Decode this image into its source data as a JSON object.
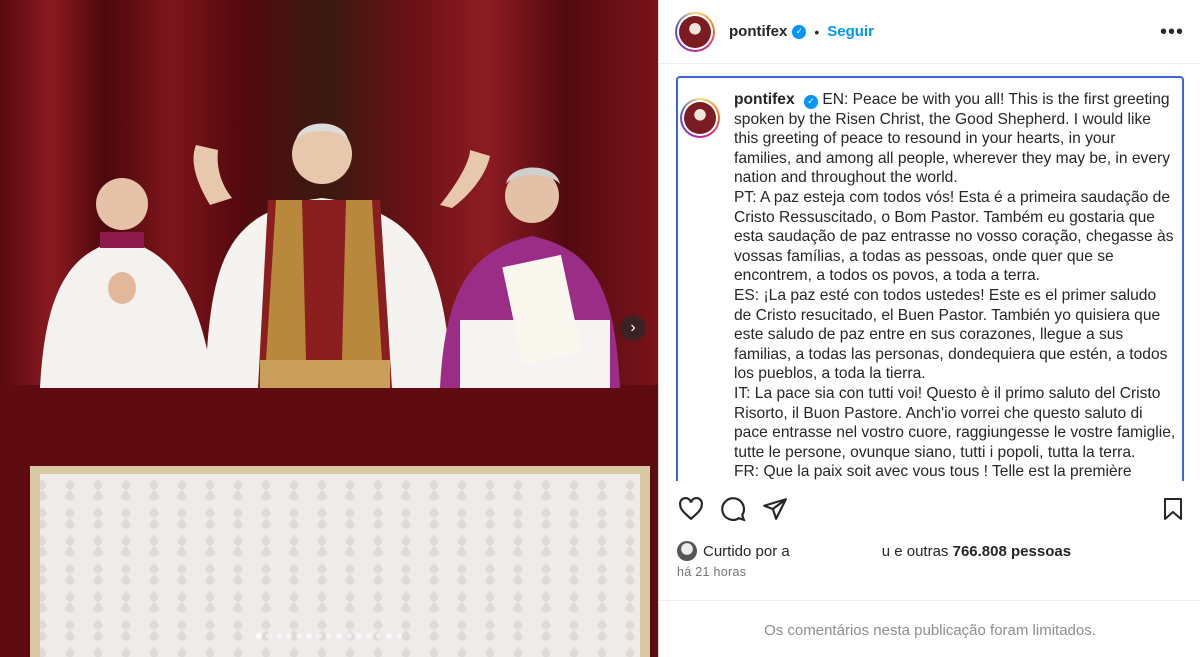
{
  "post": {
    "username": "pontifex",
    "follow_label": "Seguir",
    "separator": "•",
    "more_label": "•••"
  },
  "caption": {
    "username": "pontifex",
    "paragraphs": [
      "EN: Peace be with you all! This is the first greeting spoken by the Risen Christ, the Good Shepherd. I would like this greeting of peace to resound in your hearts, in your families, and among all people, wherever they may be, in every nation and throughout the world.",
      "PT: A paz esteja com todos vós! Esta é a primeira saudação de Cristo Ressuscitado, o Bom Pastor. Também eu gostaria que esta saudação de paz entrasse no vosso coração, chegasse às vossas famílias, a todas as pessoas, onde quer que se encontrem, a todos os povos, a toda a terra.",
      "ES: ¡La paz esté con todos ustedes! Este es el primer saludo de Cristo resucitado, el Buen Pastor. También yo quisiera que este saludo de paz entre en sus corazones, llegue a sus familias, a todas las personas, dondequiera que estén, a todos los pueblos, a toda la tierra.",
      "IT: La pace sia con tutti voi! Questo è il primo saluto del Cristo Risorto, il Buon Pastore. Anch'io vorrei che questo saluto di pace entrasse nel vostro cuore, raggiungesse le vostre famiglie, tutte le persone, ovunque siano, tutti i popoli, tutta la terra.",
      "FR: Que la paix soit avec vous tous ! Telle est la première"
    ]
  },
  "likes": {
    "prefix": "Curtido por a",
    "suffix": "u e outras",
    "count": "766.808 pessoas"
  },
  "time_ago": "há 21 horas",
  "comments_notice": "Os comentários nesta publicação foram limitados.",
  "carousel": {
    "dot_count": 15,
    "active_index": 0,
    "next_label": "›"
  },
  "colors": {
    "accent": "#0095f6",
    "focus_border": "#3b67d9",
    "curtain": "#6e0f16"
  },
  "icons": [
    "verified-badge-icon",
    "more-options-icon",
    "heart-icon",
    "comment-icon",
    "share-icon",
    "bookmark-icon",
    "chevron-right-icon"
  ]
}
